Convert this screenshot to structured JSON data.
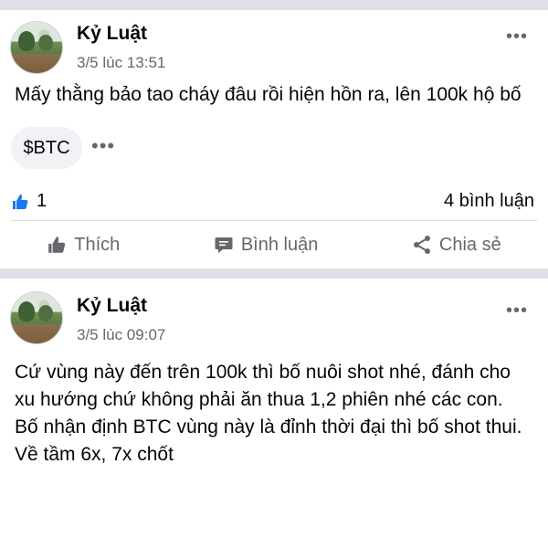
{
  "posts": [
    {
      "author": "Kỷ Luật",
      "time": "3/5 lúc 13:51",
      "text": "Mấy thằng bảo tao cháy đâu rồi hiện hồn ra, lên 100k hộ bố",
      "tag": "$BTC",
      "like_count": "1",
      "comment_count": "4 bình luận",
      "actions": {
        "like": "Thích",
        "comment": "Bình luận",
        "share": "Chia sẻ"
      }
    },
    {
      "author": "Kỷ Luật",
      "time": "3/5 lúc 09:07",
      "text": "Cứ vùng này đến trên 100k thì bố nuôi shot nhé, đánh cho xu hướng chứ không phải ăn thua 1,2 phiên nhé các con. Bố nhận định BTC vùng này là đỉnh thời đại thì bố shot thui. Về tầm 6x, 7x chốt"
    }
  ],
  "icons": {
    "more": "more-horizontal-icon",
    "like_reaction": "thumbs-up-reaction-icon",
    "like": "thumbs-up-icon",
    "comment": "comment-icon",
    "share": "share-icon"
  },
  "colors": {
    "separator": "#dfe1e6",
    "secondary_text": "#65676b",
    "like_blue": "#1877f2",
    "chip_bg": "#f0f2f5"
  }
}
